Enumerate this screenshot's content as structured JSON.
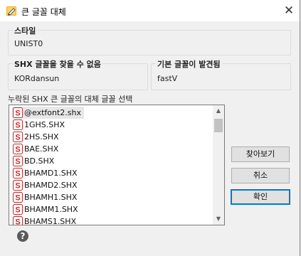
{
  "window": {
    "title": "큰 글꼴 대체",
    "close_symbol": "✕"
  },
  "style_group": {
    "label": "스타일",
    "value": "UNIST0"
  },
  "shx_group": {
    "label": "SHX 글꼴을 찾을 수 없음",
    "value": "KORdansun"
  },
  "bigfont_group": {
    "label": "기본 글꼴이 발견됨",
    "value": "fastV"
  },
  "font_list": {
    "caption": "누락된 SHX 큰 글꼴의 대체 글꼴 선택",
    "items": [
      "@extfont2.shx",
      "1GHS.SHX",
      "2HS.SHX",
      "BAE.SHX",
      "BD.SHX",
      "BHAMD1.SHX",
      "BHAMD2.SHX",
      "BHAMH1.SHX",
      "BHAMM1.SHX",
      "BHAMS1.SHX"
    ],
    "selected_index": 0,
    "item_icon": "shx-font-icon"
  },
  "buttons": {
    "browse": "찾아보기",
    "cancel": "취소",
    "ok": "확인"
  },
  "help": {
    "icon": "help-icon",
    "symbol": "?"
  },
  "colors": {
    "accent": "#0078d7",
    "icon_red": "#c62828"
  }
}
